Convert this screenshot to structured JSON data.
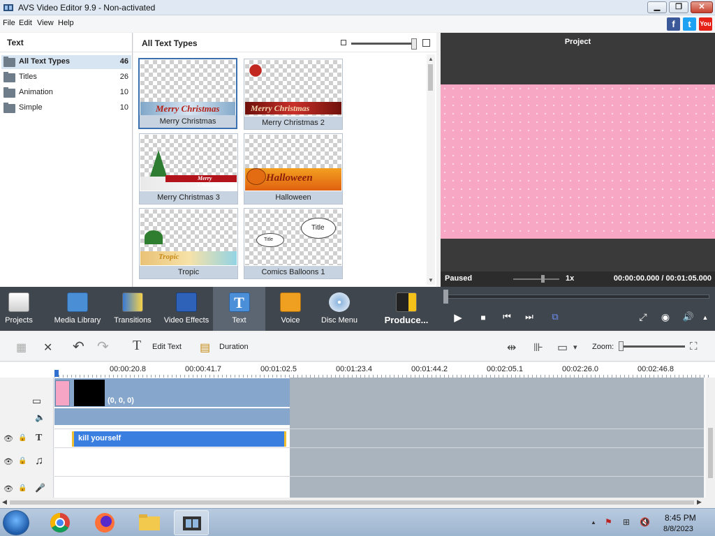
{
  "window": {
    "title": "AVS Video Editor 9.9 - Non-activated",
    "min_glyph": "▁",
    "max_glyph": "❐",
    "close_glyph": "✕"
  },
  "menu": [
    "File",
    "Edit",
    "View",
    "Help"
  ],
  "social": {
    "facebook": "f",
    "twitter": "t",
    "youtube": "You"
  },
  "left_panel": {
    "title": "Text",
    "items": [
      {
        "label": "All Text Types",
        "count": "46"
      },
      {
        "label": "Titles",
        "count": "26"
      },
      {
        "label": "Animation",
        "count": "10"
      },
      {
        "label": "Simple",
        "count": "10"
      }
    ]
  },
  "gallery": {
    "title": "All Text Types",
    "tiles": [
      {
        "caption": "Merry Christmas",
        "art": "Merry Christmas"
      },
      {
        "caption": "Merry Christmas 2",
        "art": "Merry Christmas"
      },
      {
        "caption": "Merry Christmas 3",
        "art": "Merry Christmas"
      },
      {
        "caption": "Halloween",
        "art": "Halloween"
      },
      {
        "caption": "Tropic",
        "art": "Tropic"
      },
      {
        "caption": "Comics Balloons 1",
        "art": "Title"
      }
    ]
  },
  "preview": {
    "title": "Project",
    "status": "Paused",
    "speed": "1x",
    "time_current": "00:00:00.000",
    "time_sep": "/",
    "time_total": "00:01:05.000"
  },
  "main_toolbar": {
    "tools": [
      "Projects",
      "Media Library",
      "Transitions",
      "Video Effects",
      "Text",
      "Voice",
      "Disc Menu"
    ],
    "produce": "Produce...",
    "playback": {
      "play": "▶",
      "stop": "■",
      "prev": "⏮",
      "next": "⏭",
      "frame": "⧉",
      "fullscreen": "⤢",
      "snapshot": "◉",
      "volume": "🔊",
      "expand": "▲"
    }
  },
  "timeline_toolbar": {
    "edit_text": "Edit Text",
    "duration": "Duration",
    "zoom": "Zoom:",
    "glyphs": {
      "grid": "▦",
      "delete": "✕",
      "undo": "↶",
      "redo": "↷",
      "text": "T",
      "film": "▤",
      "split": "⇹",
      "audio": "⊪",
      "monitor": "▭",
      "dropdown": "▾",
      "fit": "⛶"
    }
  },
  "ruler": {
    "ticks": [
      "00:00:20.8",
      "00:00:41.7",
      "00:01:02.5",
      "00:01:23.4",
      "00:01:44.2",
      "00:02:05.1",
      "00:02:26.0",
      "00:02:46.8"
    ]
  },
  "tracks": {
    "video_clip_label": "(0, 0, 0)",
    "text_clip_label": "kill yourself",
    "icons": {
      "film": "▭",
      "speaker": "🔈",
      "eye": "👁",
      "lock": "🔒",
      "text": "T",
      "music": "♫",
      "mic": "🎤"
    }
  },
  "taskbar": {
    "time": "8:45 PM",
    "date": "8/8/2023",
    "tray": {
      "up": "▲",
      "flag": "⚑",
      "net": "⊞",
      "vol": "🔇"
    }
  },
  "colors": {
    "accent": "#3a6fb0",
    "toolbar_bg": "#40464d",
    "text_clip": "#3a7fe0",
    "preview_pink": "#f7a6c4"
  }
}
